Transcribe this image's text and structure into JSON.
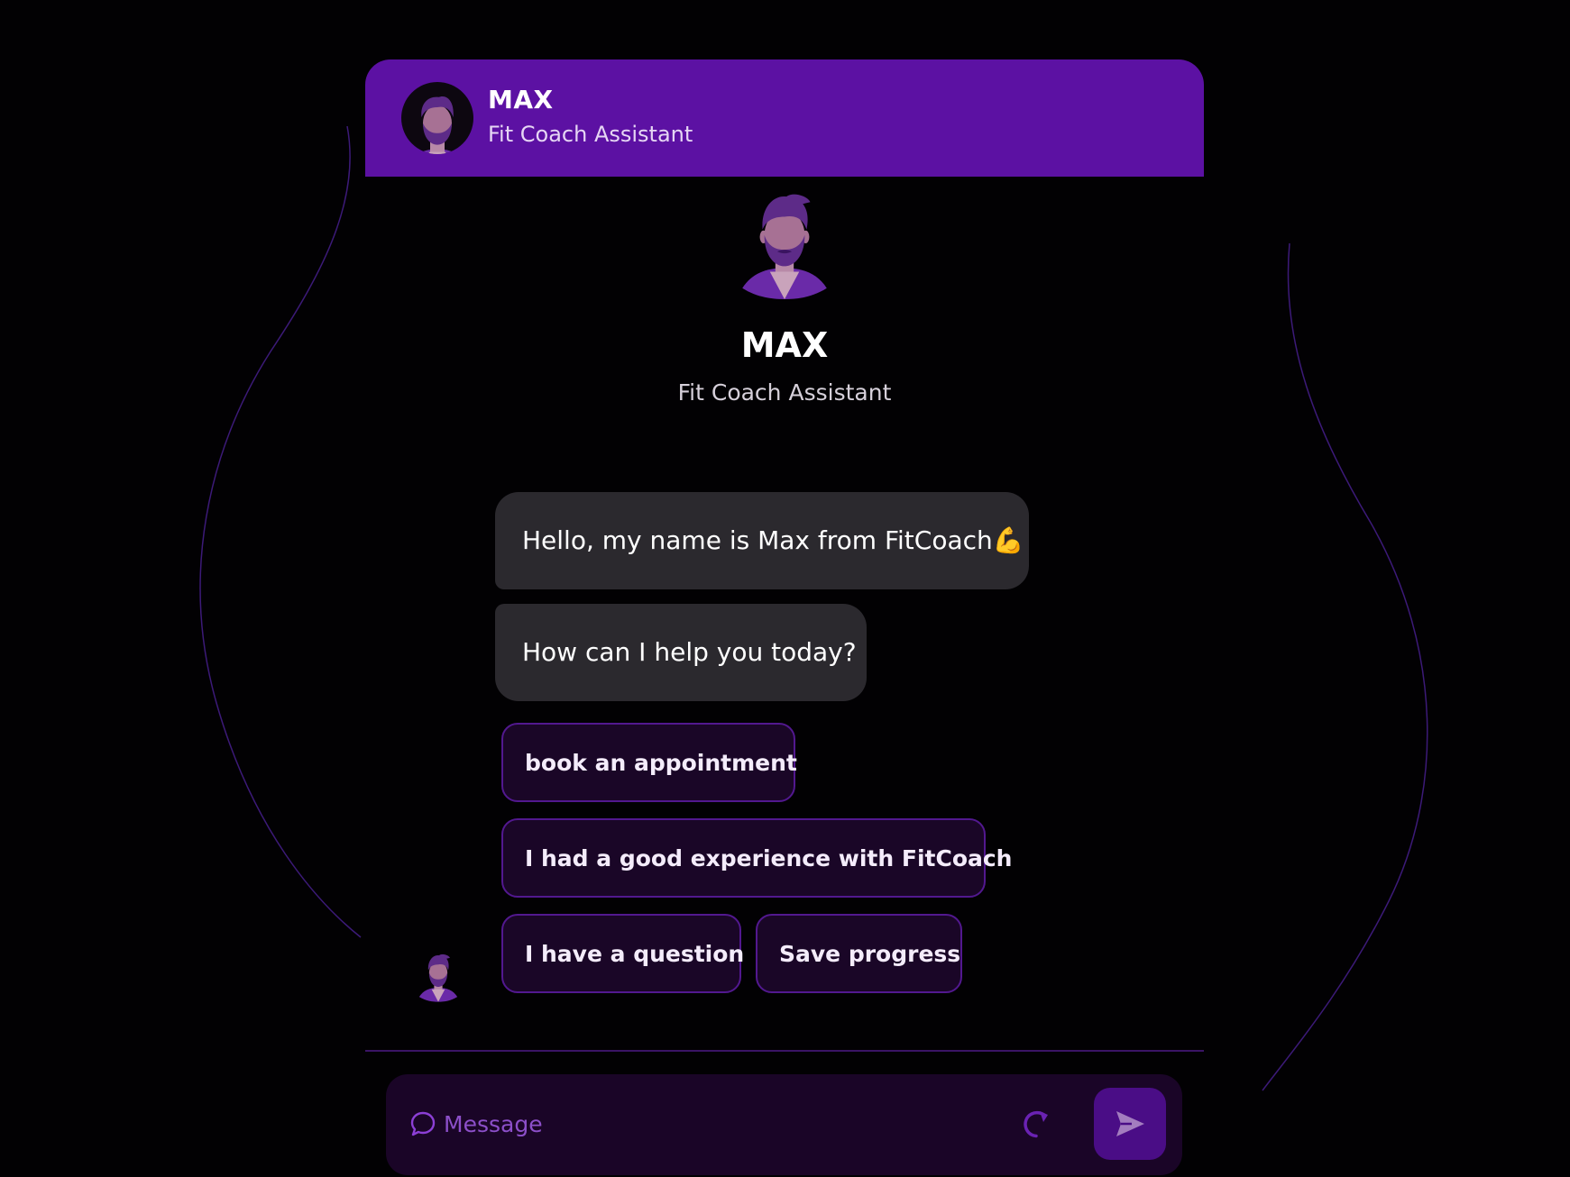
{
  "header": {
    "name": "MAX",
    "subtitle": "Fit Coach Assistant"
  },
  "intro": {
    "name": "MAX",
    "subtitle": "Fit Coach Assistant"
  },
  "messages": [
    {
      "sender": "bot",
      "text": "Hello, my name is Max from FitCoach💪"
    },
    {
      "sender": "bot",
      "text": "How can I help you today?"
    }
  ],
  "quick_replies": [
    {
      "label": "book an appointment"
    },
    {
      "label": "I had a good experience with FitCoach"
    },
    {
      "label": "I have a question"
    },
    {
      "label": "Save progress"
    }
  ],
  "composer": {
    "placeholder": "Message",
    "icons": {
      "message": "chat-bubble-icon",
      "refresh": "refresh-icon",
      "send": "send-icon"
    }
  },
  "colors": {
    "accent": "#5c11a3",
    "background": "#020103",
    "bubble": "#2b292e",
    "chip_border": "#52188f",
    "chip_bg": "#1a0627",
    "composer_bg": "#1a0527",
    "send_bg": "#4a0d86"
  }
}
